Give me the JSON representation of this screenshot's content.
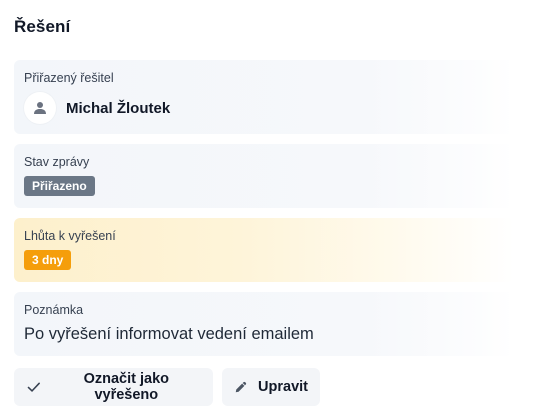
{
  "section": {
    "title": "Řešení"
  },
  "assignee": {
    "label": "Přiřazený řešitel",
    "name": "Michal Žloutek",
    "avatar_icon": "user-icon"
  },
  "status": {
    "label": "Stav zprávy",
    "badge": "Přiřazeno",
    "badge_color": "#6b7786"
  },
  "deadline": {
    "label": "Lhůta k vyřešení",
    "badge": "3 dny",
    "badge_color": "#f59e0b",
    "highlight_color": "#fdf0cc"
  },
  "note": {
    "label": "Poznámka",
    "text": "Po vyřešení informovat vedení emailem"
  },
  "actions": {
    "resolve_label": "Označit jako vyřešeno",
    "resolve_icon": "check-icon",
    "edit_label": "Upravit",
    "edit_icon": "pencil-icon"
  }
}
